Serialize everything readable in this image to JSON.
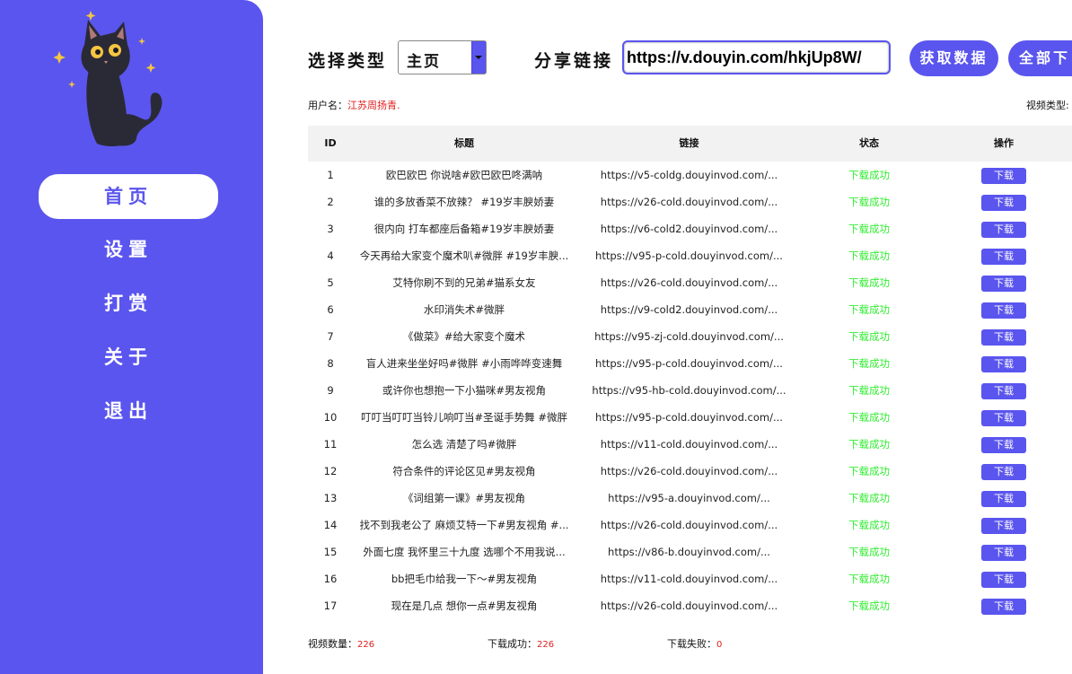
{
  "sidebar": {
    "items": [
      {
        "label": "首页",
        "active": true
      },
      {
        "label": "设置",
        "active": false
      },
      {
        "label": "打赏",
        "active": false
      },
      {
        "label": "关于",
        "active": false
      },
      {
        "label": "退出",
        "active": false
      }
    ]
  },
  "toolbar": {
    "type_label": "选择类型",
    "type_value": "主页",
    "share_label": "分享链接",
    "link_value": "https://v.douyin.com/hkjUp8W/",
    "fetch_button": "获取数据",
    "download_all_button": "全部下"
  },
  "info": {
    "username_label": "用户名：",
    "username_value": "江苏周扬青.",
    "video_type_label": "视频类型:"
  },
  "table": {
    "headers": {
      "id": "ID",
      "title": "标题",
      "link": "链接",
      "status": "状态",
      "op": "操作"
    },
    "rows": [
      {
        "id": "1",
        "title": "欧巴欧巴 你说啥#欧巴欧巴咚满呐",
        "link": "https://v5-coldg.douyinvod.com/...",
        "status": "下载成功",
        "op": "下载"
      },
      {
        "id": "2",
        "title": "谁的多放香菜不放辣？ #19岁丰腴娇妻",
        "link": "https://v26-cold.douyinvod.com/...",
        "status": "下载成功",
        "op": "下载"
      },
      {
        "id": "3",
        "title": "很内向 打车都座后备箱#19岁丰腴娇妻",
        "link": "https://v6-cold2.douyinvod.com/...",
        "status": "下载成功",
        "op": "下载"
      },
      {
        "id": "4",
        "title": "今天再给大家变个魔术叭#微胖 #19岁丰腴...",
        "link": "https://v95-p-cold.douyinvod.com/...",
        "status": "下载成功",
        "op": "下载"
      },
      {
        "id": "5",
        "title": "艾特你刷不到的兄弟#猫系女友",
        "link": "https://v26-cold.douyinvod.com/...",
        "status": "下载成功",
        "op": "下载"
      },
      {
        "id": "6",
        "title": "水印消失术#微胖",
        "link": "https://v9-cold2.douyinvod.com/...",
        "status": "下载成功",
        "op": "下载"
      },
      {
        "id": "7",
        "title": "《做菜》#给大家变个魔术",
        "link": "https://v95-zj-cold.douyinvod.com/...",
        "status": "下载成功",
        "op": "下载"
      },
      {
        "id": "8",
        "title": "盲人进来坐坐好吗#微胖 #小雨哗哗变速舞",
        "link": "https://v95-p-cold.douyinvod.com/...",
        "status": "下载成功",
        "op": "下载"
      },
      {
        "id": "9",
        "title": "或许你也想抱一下小猫咪#男友视角",
        "link": "https://v95-hb-cold.douyinvod.com/...",
        "status": "下载成功",
        "op": "下载"
      },
      {
        "id": "10",
        "title": "叮叮当叮叮当铃儿响叮当#圣诞手势舞 #微胖",
        "link": "https://v95-p-cold.douyinvod.com/...",
        "status": "下载成功",
        "op": "下载"
      },
      {
        "id": "11",
        "title": "怎么选 清楚了吗#微胖",
        "link": "https://v11-cold.douyinvod.com/...",
        "status": "下载成功",
        "op": "下载"
      },
      {
        "id": "12",
        "title": "符合条件的评论区见#男友视角",
        "link": "https://v26-cold.douyinvod.com/...",
        "status": "下载成功",
        "op": "下载"
      },
      {
        "id": "13",
        "title": "《词组第一课》#男友视角",
        "link": "https://v95-a.douyinvod.com/...",
        "status": "下载成功",
        "op": "下载"
      },
      {
        "id": "14",
        "title": "找不到我老公了 麻烦艾特一下#男友视角 #...",
        "link": "https://v26-cold.douyinvod.com/...",
        "status": "下载成功",
        "op": "下载"
      },
      {
        "id": "15",
        "title": "外面七度 我怀里三十九度 选哪个不用我说...",
        "link": "https://v86-b.douyinvod.com/...",
        "status": "下载成功",
        "op": "下载"
      },
      {
        "id": "16",
        "title": "bb把毛巾给我一下～#男友视角",
        "link": "https://v11-cold.douyinvod.com/...",
        "status": "下载成功",
        "op": "下载"
      },
      {
        "id": "17",
        "title": "现在是几点 想你一点#男友视角",
        "link": "https://v26-cold.douyinvod.com/...",
        "status": "下载成功",
        "op": "下载"
      }
    ]
  },
  "footer": {
    "count_label": "视频数量：",
    "count_value": "226",
    "success_label": "下载成功：",
    "success_value": "226",
    "fail_label": "下载失败：",
    "fail_value": "0"
  },
  "colors": {
    "accent": "#5a55ee",
    "success": "#33ee33",
    "highlight": "#e02020"
  },
  "icons": {
    "logo": "black-cat-icon",
    "dropdown": "dropdown-arrow-icon"
  }
}
